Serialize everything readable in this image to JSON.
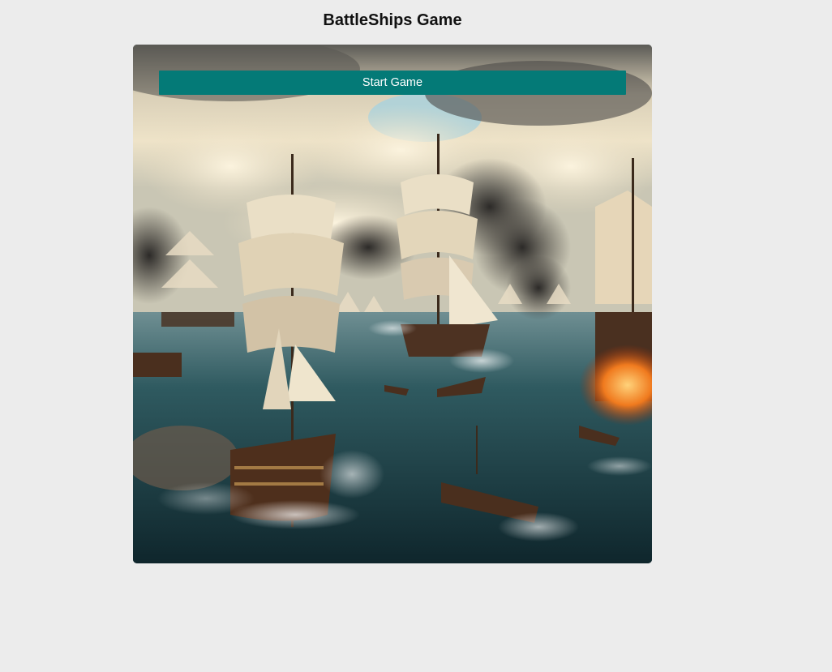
{
  "page": {
    "title": "BattleShips Game"
  },
  "game_board": {
    "start_button_label": "Start Game",
    "background_image": "naval-battle-painting"
  },
  "colors": {
    "page_background": "#ececec",
    "button_background": "#047a77",
    "button_text": "#ffffff"
  }
}
